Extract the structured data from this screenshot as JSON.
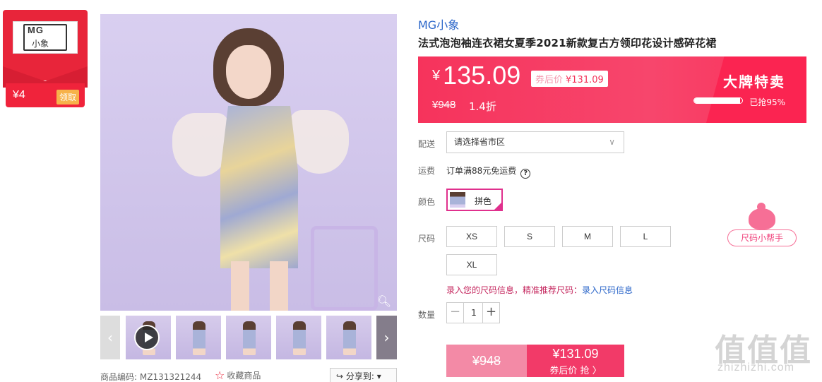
{
  "store_badge": {
    "logo_text_top": "MG",
    "logo_text_bottom": "小象",
    "coupon_amount": "¥4",
    "coupon_action": "领取",
    "color": "#e8253a"
  },
  "gallery": {
    "zoom_icon": "magnifier-icon",
    "prev_icon": "chevron-left-icon",
    "next_icon": "chevron-right-icon",
    "play_icon": "play-icon"
  },
  "product_meta": {
    "code_label": "商品编码:",
    "code_value": "MZ131321244",
    "favorite_label": "收藏商品",
    "share_label": "分享到:",
    "share_caret": "▾"
  },
  "product": {
    "brand": "MG小象",
    "title": "法式泡泡袖连衣裙女夏季2021新款复古方领印花设计感碎花裙"
  },
  "price": {
    "currency": "¥",
    "current": "135.09",
    "coupon_label": "券后价",
    "coupon_price": "¥131.09",
    "original": "¥948",
    "discount": "1.4折",
    "promo_title": "大牌特卖",
    "sold_ratio": 0.95,
    "sold_text": "已抢95%",
    "banner_color": "#f6335c"
  },
  "delivery": {
    "label": "配送",
    "placeholder": "请选择省市区"
  },
  "shipping": {
    "label": "运费",
    "text": "订单满88元免运费"
  },
  "color": {
    "label": "颜色",
    "option": "拼色"
  },
  "size": {
    "label": "尺码",
    "options": [
      "XS",
      "S",
      "M",
      "L",
      "XL"
    ],
    "helper": "尺码小帮手",
    "tip": "录入您的尺码信息，精准推荐尺码：",
    "tip_link": "录入尺码信息"
  },
  "quantity": {
    "label": "数量",
    "minus": "−",
    "value": "1",
    "plus": "+"
  },
  "buy": {
    "original_price": "¥948",
    "coupon_price": "¥131.09",
    "coupon_action": "券后价 抢 〉"
  },
  "watermark": {
    "chars": "值值值",
    "url": "zhizhizhi.com"
  }
}
